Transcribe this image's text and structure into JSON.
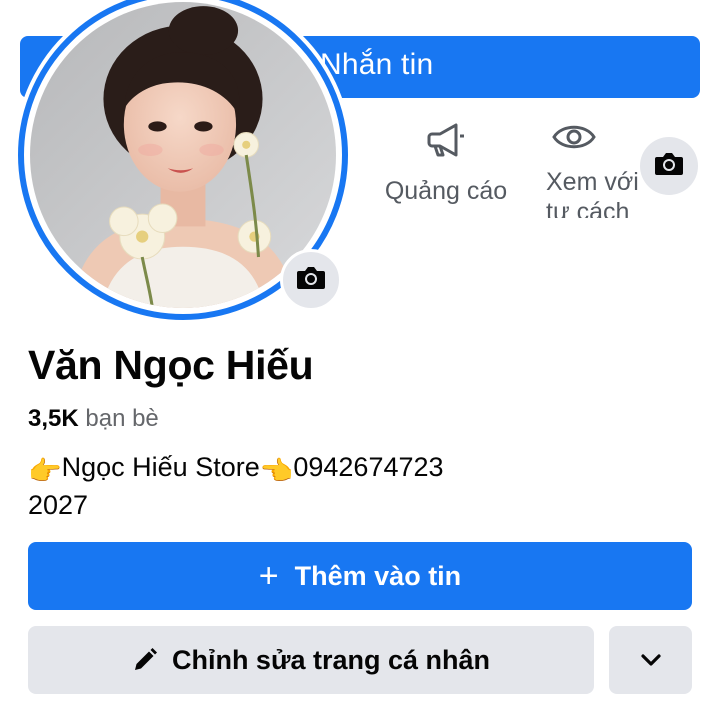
{
  "cover": {
    "message_label": "Nhắn tin",
    "actions": [
      {
        "icon": "megaphone-icon",
        "label": "Quảng cáo"
      },
      {
        "icon": "eye-icon",
        "label": "Xem với tư cách"
      }
    ],
    "camera_icon": "camera-icon"
  },
  "profile": {
    "name": "Văn Ngọc Hiếu",
    "friends_count": "3,5K",
    "friends_label": "bạn bè",
    "bio_hand_left": "👉",
    "bio_store": "Ngọc Hiếu Store",
    "bio_hand_right": "👈",
    "bio_phone": "0942674723",
    "bio_line2": "2027"
  },
  "buttons": {
    "add_story_plus": "+",
    "add_story": "Thêm vào tin",
    "edit_profile": "Chỉnh sửa trang cá nhân"
  },
  "colors": {
    "brand_blue": "#1877f2",
    "button_gray": "#e4e6eb",
    "secondary_text": "#65676b"
  }
}
